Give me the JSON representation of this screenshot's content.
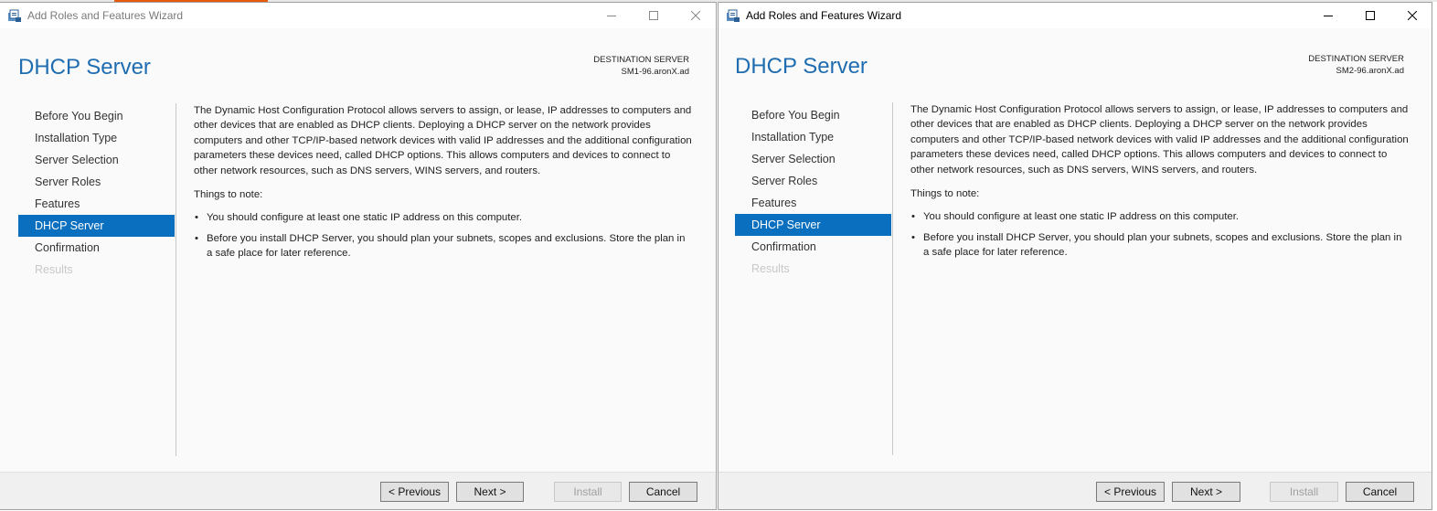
{
  "windows": [
    {
      "title": "Add Roles and Features Wizard",
      "page_title": "DHCP Server",
      "destination_label": "DESTINATION SERVER",
      "destination_server": "SM1-96.aronX.ad",
      "nav": [
        {
          "label": "Before You Begin",
          "state": "normal"
        },
        {
          "label": "Installation Type",
          "state": "normal"
        },
        {
          "label": "Server Selection",
          "state": "normal"
        },
        {
          "label": "Server Roles",
          "state": "normal"
        },
        {
          "label": "Features",
          "state": "normal"
        },
        {
          "label": "DHCP Server",
          "state": "selected"
        },
        {
          "label": "Confirmation",
          "state": "normal"
        },
        {
          "label": "Results",
          "state": "disabled"
        }
      ],
      "description": "The Dynamic Host Configuration Protocol allows servers to assign, or lease, IP addresses to computers and other devices that are enabled as DHCP clients. Deploying a DHCP server on the network provides computers and other TCP/IP-based network devices with valid IP addresses and the additional configuration parameters these devices need, called DHCP options. This allows computers and devices to connect to other network resources, such as DNS servers, WINS servers, and routers.",
      "things_to_note": "Things to note:",
      "notes": [
        "You should configure at least one static IP address on this computer.",
        "Before you install DHCP Server, you should plan your subnets, scopes and exclusions. Store the plan in a safe place for later reference."
      ],
      "buttons": {
        "previous": "< Previous",
        "next": "Next >",
        "install": "Install",
        "cancel": "Cancel"
      }
    },
    {
      "title": "Add Roles and Features Wizard",
      "page_title": "DHCP Server",
      "destination_label": "DESTINATION SERVER",
      "destination_server": "SM2-96.aronX.ad",
      "nav": [
        {
          "label": "Before You Begin",
          "state": "normal"
        },
        {
          "label": "Installation Type",
          "state": "normal"
        },
        {
          "label": "Server Selection",
          "state": "normal"
        },
        {
          "label": "Server Roles",
          "state": "normal"
        },
        {
          "label": "Features",
          "state": "normal"
        },
        {
          "label": "DHCP Server",
          "state": "selected"
        },
        {
          "label": "Confirmation",
          "state": "normal"
        },
        {
          "label": "Results",
          "state": "disabled"
        }
      ],
      "description": "The Dynamic Host Configuration Protocol allows servers to assign, or lease, IP addresses to computers and other devices that are enabled as DHCP clients. Deploying a DHCP server on the network provides computers and other TCP/IP-based network devices with valid IP addresses and the additional configuration parameters these devices need, called DHCP options. This allows computers and devices to connect to other network resources, such as DNS servers, WINS servers, and routers.",
      "things_to_note": "Things to note:",
      "notes": [
        "You should configure at least one static IP address on this computer.",
        "Before you install DHCP Server, you should plan your subnets, scopes and exclusions. Store the plan in a safe place for later reference."
      ],
      "buttons": {
        "previous": "< Previous",
        "next": "Next >",
        "install": "Install",
        "cancel": "Cancel"
      }
    }
  ],
  "colors": {
    "accent": "#1f6db0",
    "selected_nav": "#0a6fbe",
    "taskbar_orange": "#e8590c",
    "inactive_title": "#7a7a7a"
  },
  "icons": {
    "app": "server-manager-icon",
    "minimize": "minimize-icon",
    "maximize": "maximize-icon",
    "close": "close-icon"
  }
}
